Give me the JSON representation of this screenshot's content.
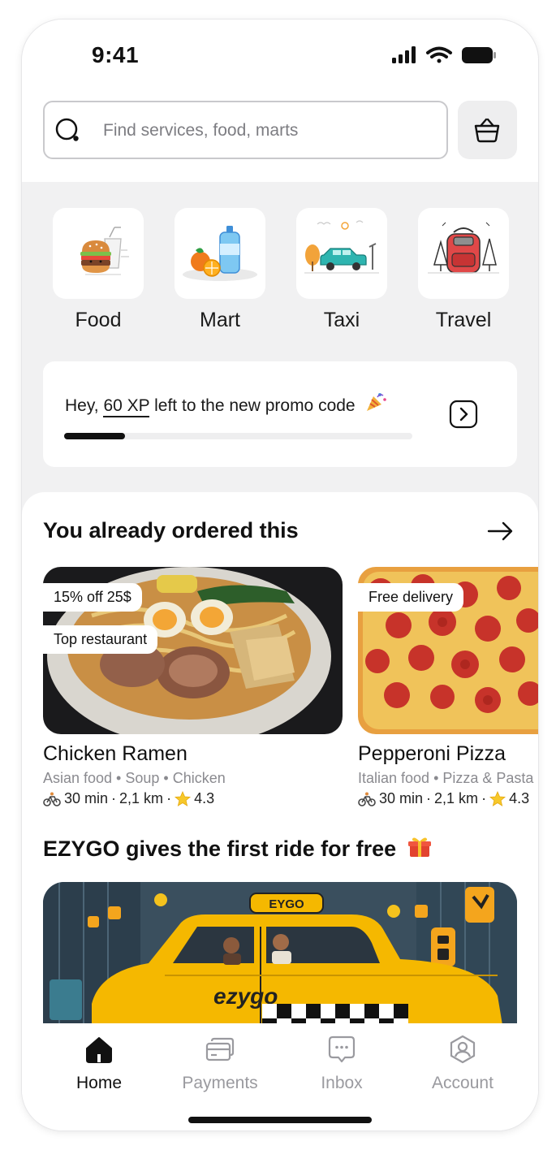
{
  "status_bar": {
    "time": "9:41",
    "icons": [
      "signal-icon",
      "wifi-icon",
      "battery-icon"
    ]
  },
  "search": {
    "placeholder": "Find services, food, marts"
  },
  "categories": [
    {
      "label": "Food",
      "icon": "burger-icon"
    },
    {
      "label": "Mart",
      "icon": "groceries-icon"
    },
    {
      "label": "Taxi",
      "icon": "taxi-icon"
    },
    {
      "label": "Travel",
      "icon": "backpack-icon"
    }
  ],
  "promo": {
    "prefix": "Hey, ",
    "xp": "60 XP",
    "suffix": " left to the new promo code",
    "progress": 0.175
  },
  "reorder": {
    "title": "You already ordered this",
    "items": [
      {
        "name": "Chicken Ramen",
        "tags": "Asian food • Soup • Chicken",
        "time": "30 min",
        "distance": "2,1 km",
        "rating": "4.3",
        "badges": [
          "15% off 25$",
          "Top restaurant"
        ]
      },
      {
        "name": "Pepperoni Pizza",
        "tags": "Italian food • Pizza & Pasta",
        "time": "30 min",
        "distance": "2,1 km",
        "rating": "4.3",
        "badges": [
          "Free delivery"
        ]
      }
    ]
  },
  "ride_promo": {
    "title": "EZYGO gives the first ride for free",
    "brand": "ezygo",
    "roof_sign": "EYGO"
  },
  "nav": [
    {
      "label": "Home",
      "active": true
    },
    {
      "label": "Payments",
      "active": false
    },
    {
      "label": "Inbox",
      "active": false
    },
    {
      "label": "Account",
      "active": false
    }
  ],
  "colors": {
    "accent": "#111111",
    "taxi_yellow": "#f5b800",
    "muted_text": "#8a8a8f",
    "background": "#f1f1f2"
  }
}
